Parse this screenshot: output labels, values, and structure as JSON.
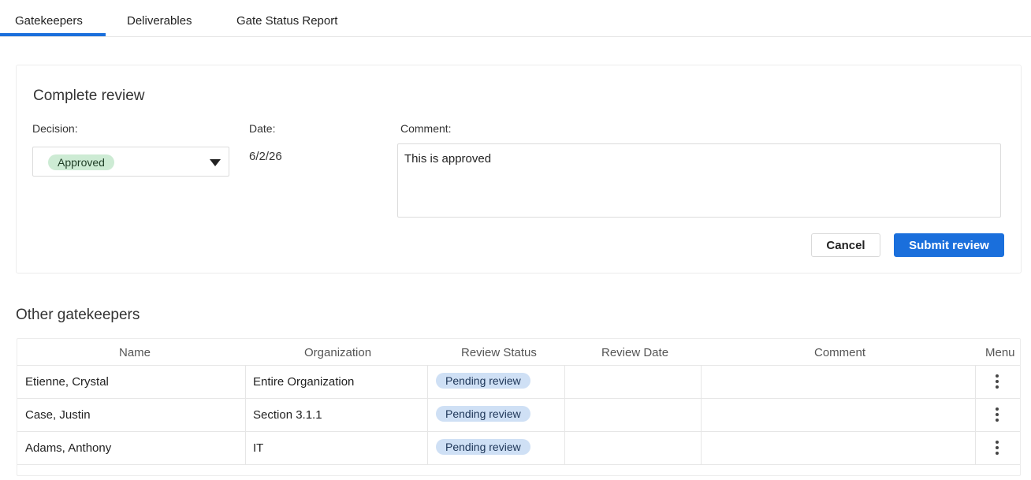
{
  "tabs": [
    {
      "label": "Gatekeepers",
      "active": true
    },
    {
      "label": "Deliverables",
      "active": false
    },
    {
      "label": "Gate Status Report",
      "active": false
    }
  ],
  "review": {
    "title": "Complete review",
    "decision_label": "Decision:",
    "decision_value": "Approved",
    "date_label": "Date:",
    "date_value": "6/2/26",
    "comment_label": "Comment:",
    "comment_value": "This is approved",
    "cancel_label": "Cancel",
    "submit_label": "Submit review"
  },
  "other": {
    "title": "Other gatekeepers",
    "columns": [
      "Name",
      "Organization",
      "Review Status",
      "Review Date",
      "Comment",
      "Menu"
    ],
    "rows": [
      {
        "name": "Etienne, Crystal",
        "organization": "Entire Organization",
        "status": "Pending review",
        "date": "",
        "comment": ""
      },
      {
        "name": "Case, Justin",
        "organization": "Section 3.1.1",
        "status": "Pending review",
        "date": "",
        "comment": ""
      },
      {
        "name": "Adams, Anthony",
        "organization": "IT",
        "status": "Pending review",
        "date": "",
        "comment": ""
      }
    ]
  },
  "colors": {
    "accent": "#1a6fdc",
    "approved_pill": "#cdebd4",
    "pending_pill": "#cfe0f5"
  },
  "icons": {
    "dropdown": "caret-down-icon",
    "row_menu": "more-vertical-icon"
  }
}
